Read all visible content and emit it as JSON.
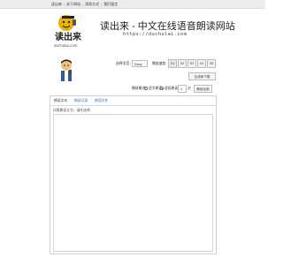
{
  "nav": {
    "items": [
      "读出来",
      "关于网站",
      "测耳方式",
      "我们留言"
    ]
  },
  "header": {
    "logo_text": "读出来",
    "logo_subtext": "duchulai.com",
    "title": "读出来 - 中文在线语音朗读网站",
    "url": "https://duchulai.com"
  },
  "controls": {
    "voice_label": "选择发音:",
    "voice_value": "Davy",
    "speed_label": "播放速度:",
    "speeds": [
      "X1",
      "X2",
      "X3",
      "X4",
      "X5"
    ],
    "active_speed_index": 0,
    "generate_button": "生成和下载",
    "mode_label": "播放模式:",
    "mode_options": [
      "逐字朗读",
      "逐段朗读"
    ],
    "mode_selected_index": 1,
    "repeat_value": "1",
    "repeat_suffix": "次",
    "read_button": "朗读全部"
  },
  "editor": {
    "tabs": [
      "朗读文本",
      "朗读记录",
      "朗读文件"
    ],
    "hint": "如需朗读文字，请先选择...",
    "text": ""
  },
  "colors": {
    "topbar": "#ececec",
    "link": "#3a6fb0",
    "border": "#cfcfcf"
  }
}
